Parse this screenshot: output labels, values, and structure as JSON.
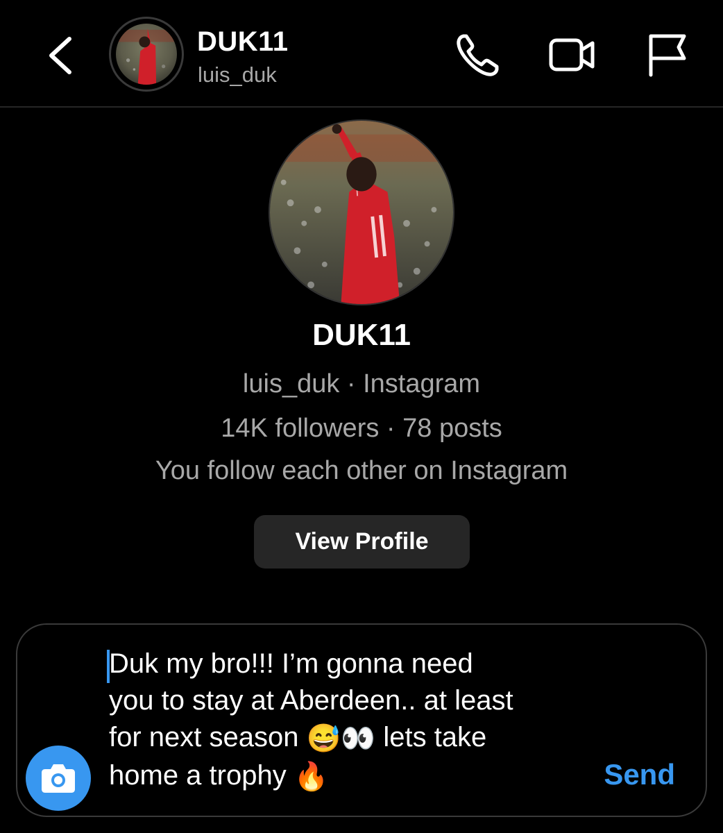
{
  "header": {
    "display_name": "DUK11",
    "username": "luis_duk",
    "icons": [
      "back-chevron-icon",
      "phone-icon",
      "video-camera-icon",
      "flag-icon"
    ]
  },
  "profile": {
    "display_name": "DUK11",
    "line1": "luis_duk · Instagram",
    "line2": "14K followers · 78 posts",
    "line3": "You follow each other on Instagram",
    "view_profile_label": "View Profile"
  },
  "composer": {
    "message_line1": "Duk my bro!!! I’m gonna need",
    "message_line2": "you to stay at Aberdeen.. at least",
    "message_line3_start": "for next season ",
    "message_line3_emoji": "😅👀",
    "message_line3_end": " lets take",
    "message_line4_start": "home a trophy ",
    "message_line4_emoji": "🔥",
    "send_label": "Send",
    "camera_icon": "camera-icon"
  },
  "colors": {
    "background": "#000000",
    "accent": "#3897f0",
    "secondary_text": "#a8a8a8",
    "button_bg": "#262626",
    "jersey": "#d0202a"
  }
}
